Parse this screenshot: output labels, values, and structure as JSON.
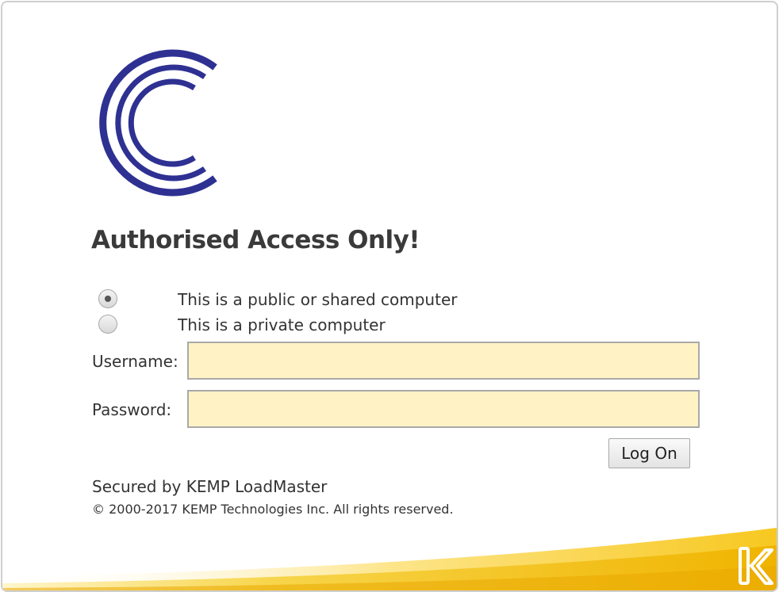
{
  "branding": {
    "logo_icon": "c-logo-icon",
    "logo_color": "#2e3192",
    "footer_icon": "kemp-k-icon",
    "footer_color": "#f2c100"
  },
  "heading": "Authorised Access Only!",
  "computer_type": {
    "options": [
      {
        "label": "This is a public or shared computer",
        "selected": true
      },
      {
        "label": "This is a private computer",
        "selected": false
      }
    ]
  },
  "form": {
    "username_label": "Username:",
    "username_value": "",
    "password_label": "Password:",
    "password_value": "",
    "field_background": "#fff3c6",
    "submit_label": "Log On"
  },
  "footer": {
    "secured_by": "Secured by KEMP LoadMaster",
    "copyright": "© 2000-2017 KEMP Technologies Inc. All rights reserved."
  }
}
